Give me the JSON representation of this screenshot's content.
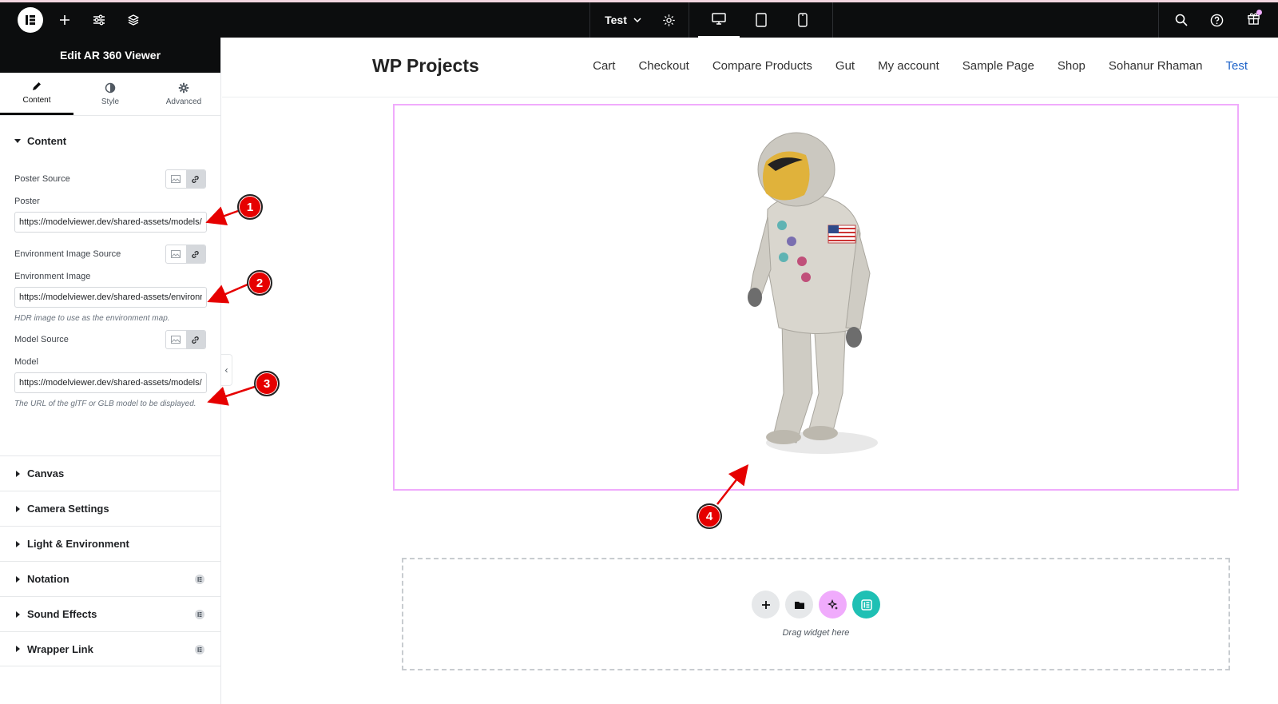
{
  "topbar": {
    "page_name": "Test",
    "icons": [
      "elementor-logo-icon",
      "plus-icon",
      "sliders-icon",
      "layers-icon",
      "chevron-down-icon",
      "gear-icon",
      "desktop-icon",
      "tablet-icon",
      "mobile-icon",
      "search-icon",
      "help-icon",
      "gift-icon"
    ]
  },
  "panel": {
    "title": "Edit AR 360 Viewer",
    "tabs": [
      {
        "label": "Content",
        "icon": "pencil-icon",
        "active": true
      },
      {
        "label": "Style",
        "icon": "half-circle-icon",
        "active": false
      },
      {
        "label": "Advanced",
        "icon": "gear-icon",
        "active": false
      }
    ],
    "content_section": {
      "title": "Content",
      "poster_source_label": "Poster Source",
      "poster_label": "Poster",
      "poster_value": "https://modelviewer.dev/shared-assets/models/",
      "env_source_label": "Environment Image Source",
      "env_label": "Environment Image",
      "env_value": "https://modelviewer.dev/shared-assets/environments/",
      "env_help": "HDR image to use as the environment map.",
      "model_source_label": "Model Source",
      "model_label": "Model",
      "model_value": "https://modelviewer.dev/shared-assets/models/",
      "model_help": "The URL of the glTF or GLB model to be displayed."
    },
    "sections": [
      {
        "label": "Canvas",
        "pro": false
      },
      {
        "label": "Camera Settings",
        "pro": false
      },
      {
        "label": "Light & Environment",
        "pro": false
      },
      {
        "label": "Notation",
        "pro": true
      },
      {
        "label": "Sound Effects",
        "pro": true
      },
      {
        "label": "Wrapper Link",
        "pro": true
      }
    ]
  },
  "site": {
    "title": "WP Projects",
    "nav": [
      "Cart",
      "Checkout",
      "Compare Products",
      "Gut",
      "My account",
      "Sample Page",
      "Shop",
      "Sohanur Rhaman",
      "Test"
    ],
    "active_nav": "Test",
    "dropzone_text": "Drag widget here"
  },
  "markers": [
    "1",
    "2",
    "3",
    "4"
  ],
  "colors": {
    "topbar_bg": "#0c0d0e",
    "viewer_border": "#f0abfc",
    "active_link": "#1e63c9",
    "marker_red": "#e60000",
    "elementor_teal": "#1fc0b4"
  }
}
